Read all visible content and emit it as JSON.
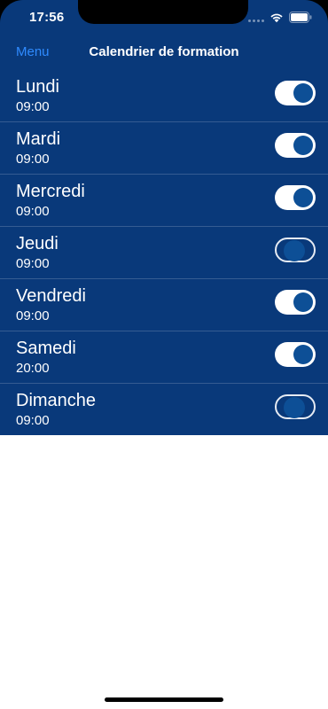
{
  "status_bar": {
    "time": "17:56",
    "icons": [
      "signal-icon",
      "wifi-icon",
      "battery-icon"
    ]
  },
  "nav": {
    "menu_label": "Menu",
    "title": "Calendrier de formation"
  },
  "colors": {
    "background": "#09397a",
    "accent": "#2f8bff",
    "toggle_knob": "#0d4f96"
  },
  "days": [
    {
      "day": "Lundi",
      "time": "09:00",
      "enabled": true
    },
    {
      "day": "Mardi",
      "time": "09:00",
      "enabled": true
    },
    {
      "day": "Mercredi",
      "time": "09:00",
      "enabled": true
    },
    {
      "day": "Jeudi",
      "time": "09:00",
      "enabled": false
    },
    {
      "day": "Vendredi",
      "time": "09:00",
      "enabled": true
    },
    {
      "day": "Samedi",
      "time": "20:00",
      "enabled": true
    },
    {
      "day": "Dimanche",
      "time": "09:00",
      "enabled": false
    }
  ]
}
